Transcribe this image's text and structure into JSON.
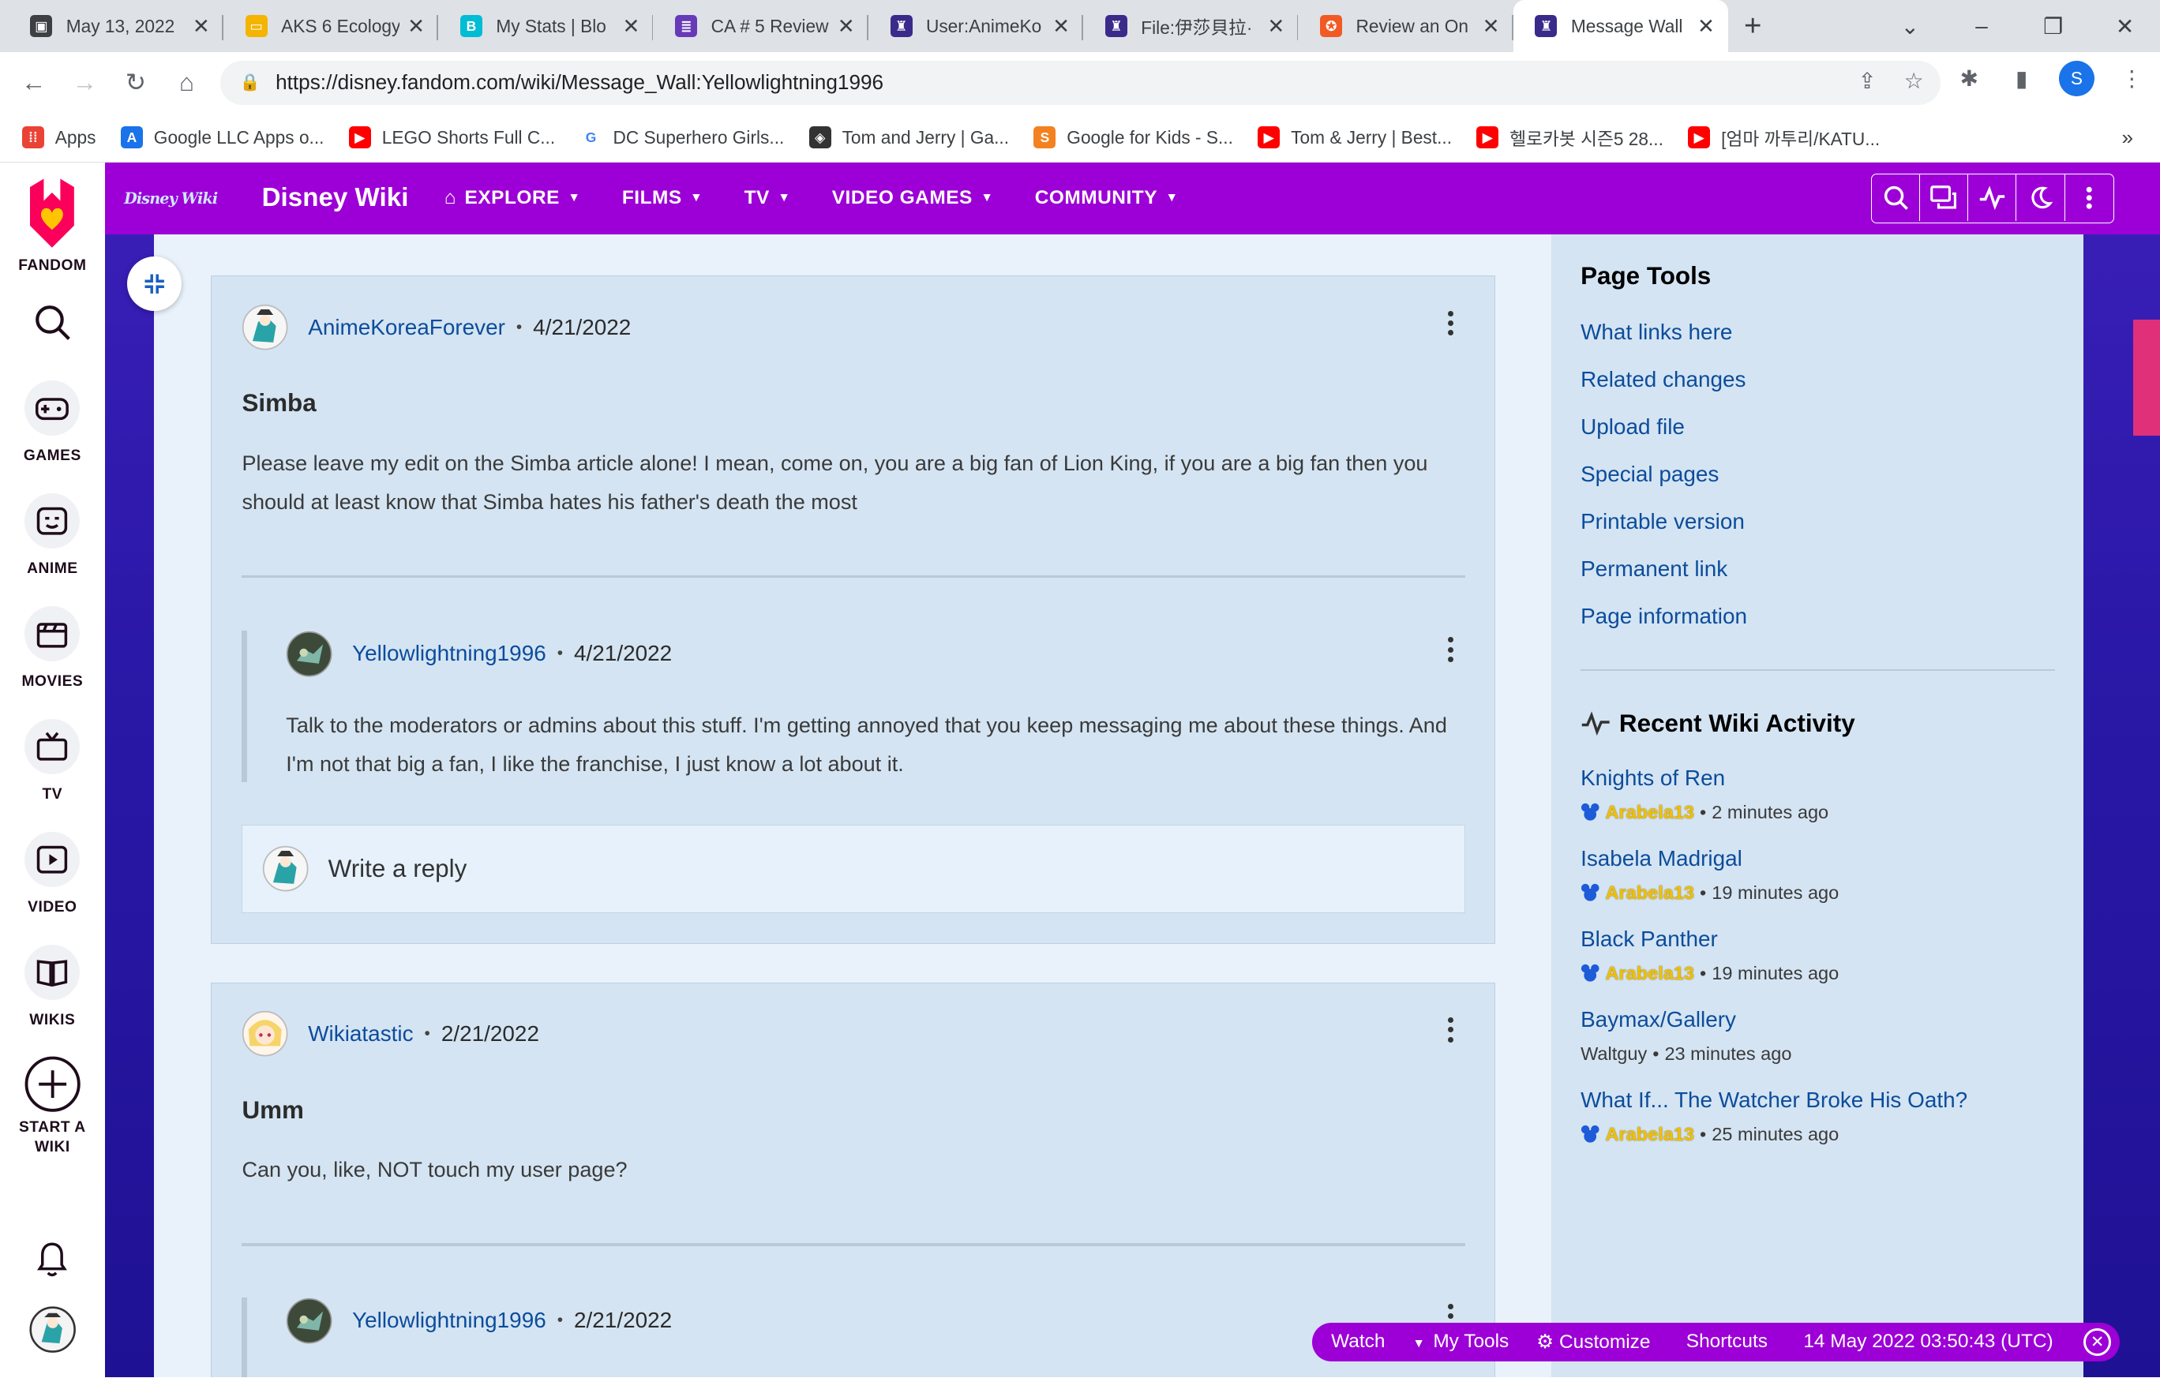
{
  "browser": {
    "tabs": [
      {
        "title": "May 13, 2022",
        "color": "#3c4043",
        "glyph": "▣"
      },
      {
        "title": "AKS 6 Ecology",
        "color": "#f4b400",
        "glyph": "▭"
      },
      {
        "title": "My Stats | Blo",
        "color": "#00bcd4",
        "glyph": "B"
      },
      {
        "title": "CA # 5 Review",
        "color": "#673ab7",
        "glyph": "≣"
      },
      {
        "title": "User:AnimeKo",
        "color": "#3a2a8a",
        "glyph": "♜"
      },
      {
        "title": "File:伊莎貝拉·",
        "color": "#3a2a8a",
        "glyph": "♜"
      },
      {
        "title": "Review an On",
        "color": "#f15a24",
        "glyph": "✪"
      },
      {
        "title": "Message Wall",
        "color": "#3a2a8a",
        "glyph": "♜"
      }
    ],
    "url": "https://disney.fandom.com/wiki/Message_Wall:Yellowlightning1996",
    "profile_initial": "S",
    "bookmarks": [
      {
        "label": "Apps",
        "color": "#ea4335",
        "glyph": "⁞⁞"
      },
      {
        "label": "Google LLC Apps o...",
        "color": "#1a73e8",
        "glyph": "A"
      },
      {
        "label": "LEGO Shorts Full C...",
        "color": "#ff0000",
        "glyph": "▶"
      },
      {
        "label": "DC Superhero Girls...",
        "color": "#ffffff",
        "glyph": "G"
      },
      {
        "label": "Tom and Jerry | Ga...",
        "color": "#333333",
        "glyph": "◈"
      },
      {
        "label": "Google for Kids - S...",
        "color": "#f48120",
        "glyph": "S"
      },
      {
        "label": "Tom & Jerry | Best...",
        "color": "#ff0000",
        "glyph": "▶"
      },
      {
        "label": "헬로카봇 시즌5 28...",
        "color": "#ff0000",
        "glyph": "▶"
      },
      {
        "label": "[엄마 까투리/KATU...",
        "color": "#ff0000",
        "glyph": "▶"
      }
    ],
    "bookmarks_more": "»"
  },
  "fandom_nav": {
    "brand": "FANDOM",
    "items": [
      {
        "label": "GAMES"
      },
      {
        "label": "ANIME"
      },
      {
        "label": "MOVIES"
      },
      {
        "label": "TV"
      },
      {
        "label": "VIDEO"
      },
      {
        "label": "WIKIS"
      },
      {
        "label": "START A WIKI"
      }
    ]
  },
  "wiki": {
    "logo_text": "Disney Wiki",
    "name": "Disney Wiki",
    "nav": [
      "EXPLORE",
      "FILMS",
      "TV",
      "VIDEO GAMES",
      "COMMUNITY"
    ],
    "accent": "#9c00d6"
  },
  "threads": [
    {
      "author": "AnimeKoreaForever",
      "date": "4/21/2022",
      "title": "Simba",
      "body": "Please leave my edit on the Simba article alone! I mean, come on, you are a big fan of Lion King, if you are a big fan then you should at least know that Simba hates his father's death the most",
      "reply": {
        "author": "Yellowlightning1996",
        "date": "4/21/2022",
        "body": "Talk to the moderators or admins about this stuff. I'm getting annoyed that you keep messaging me about these things. And I'm not that big a fan, I like the franchise, I just know a lot about it."
      },
      "reply_placeholder": "Write a reply"
    },
    {
      "author": "Wikiatastic",
      "date": "2/21/2022",
      "title": "Umm",
      "body": "Can you, like, NOT touch my user page?",
      "reply": {
        "author": "Yellowlightning1996",
        "date": "2/21/2022"
      }
    }
  ],
  "rail": {
    "page_tools_title": "Page Tools",
    "page_tools": [
      "What links here",
      "Related changes",
      "Upload file",
      "Special pages",
      "Printable version",
      "Permanent link",
      "Page information"
    ],
    "activity_title": "Recent Wiki Activity",
    "activity": [
      {
        "page": "Knights of Ren",
        "user": "Arabela13",
        "time": "2 minutes ago",
        "badge": true
      },
      {
        "page": "Isabela Madrigal",
        "user": "Arabela13",
        "time": "19 minutes ago",
        "badge": true
      },
      {
        "page": "Black Panther",
        "user": "Arabela13",
        "time": "19 minutes ago",
        "badge": true
      },
      {
        "page": "Baymax/Gallery",
        "user": "Waltguy",
        "time": "23 minutes ago",
        "badge": false
      },
      {
        "page": "What If... The Watcher Broke His Oath?",
        "user": "Arabela13",
        "time": "25 minutes ago",
        "badge": true
      }
    ]
  },
  "bottom_toolbar": {
    "watch": "Watch",
    "my_tools": "My Tools",
    "customize": "Customize",
    "shortcuts": "Shortcuts",
    "clock": "14 May 2022 03:50:43 (UTC)"
  }
}
